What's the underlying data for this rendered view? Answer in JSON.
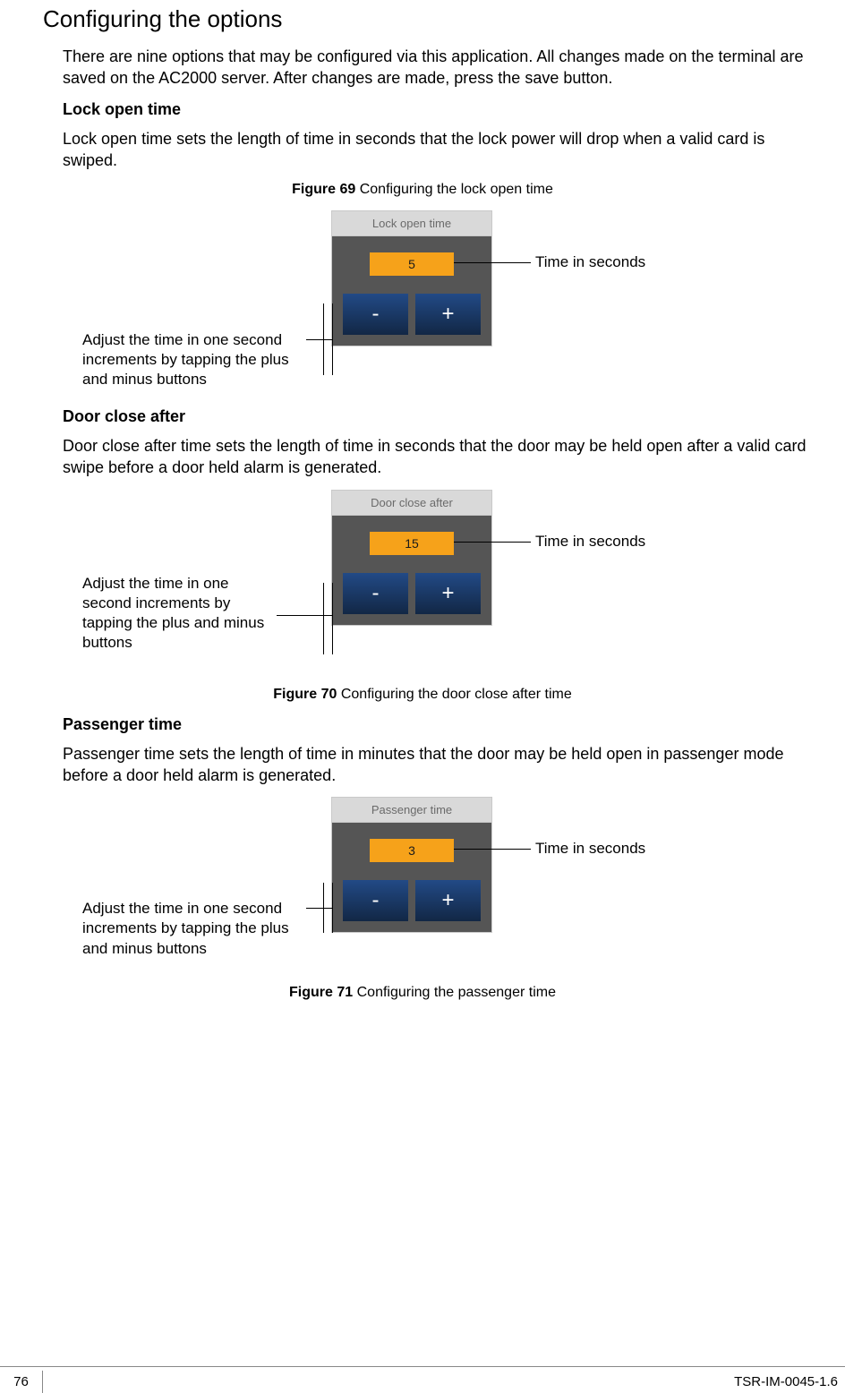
{
  "title": "Configuring the options",
  "intro": "There are nine options that may be configured via this application. All changes made on the terminal are saved on the AC2000 server. After changes are made, press the save button.",
  "sections": {
    "lockOpen": {
      "heading": "Lock open time",
      "text": "Lock open time sets the length of time in seconds that the lock power will drop when a valid card is swiped.",
      "figNum": "Figure 69",
      "figText": " Configuring the lock open time",
      "widgetTitle": "Lock open time",
      "value": "5",
      "calloutRight": "Time in seconds",
      "calloutLeft": "Adjust the time in one second increments by tapping the plus and minus buttons"
    },
    "doorClose": {
      "heading": "Door close after",
      "text": "Door close after time sets the length of time in seconds that the door may be held open after a valid card swipe before a door held alarm is generated.",
      "figNum": "Figure 70",
      "figText": " Configuring the door close after time",
      "widgetTitle": "Door close after",
      "value": "15",
      "calloutRight": "Time in seconds",
      "calloutLeft": "Adjust the time in one second increments by tapping the plus and minus buttons"
    },
    "passenger": {
      "heading": "Passenger time",
      "text": "Passenger time sets the length of time in minutes that the door may be held open in passenger mode before a door held alarm is generated.",
      "figNum": "Figure 71",
      "figText": " Configuring the passenger time",
      "widgetTitle": "Passenger time",
      "value": "3",
      "calloutRight": "Time in seconds",
      "calloutLeft": "Adjust the time in one second increments by tapping the plus and minus buttons"
    }
  },
  "buttons": {
    "minus": "-",
    "plus": "+"
  },
  "footer": {
    "page": "76",
    "docId": "TSR-IM-0045-1.6"
  }
}
